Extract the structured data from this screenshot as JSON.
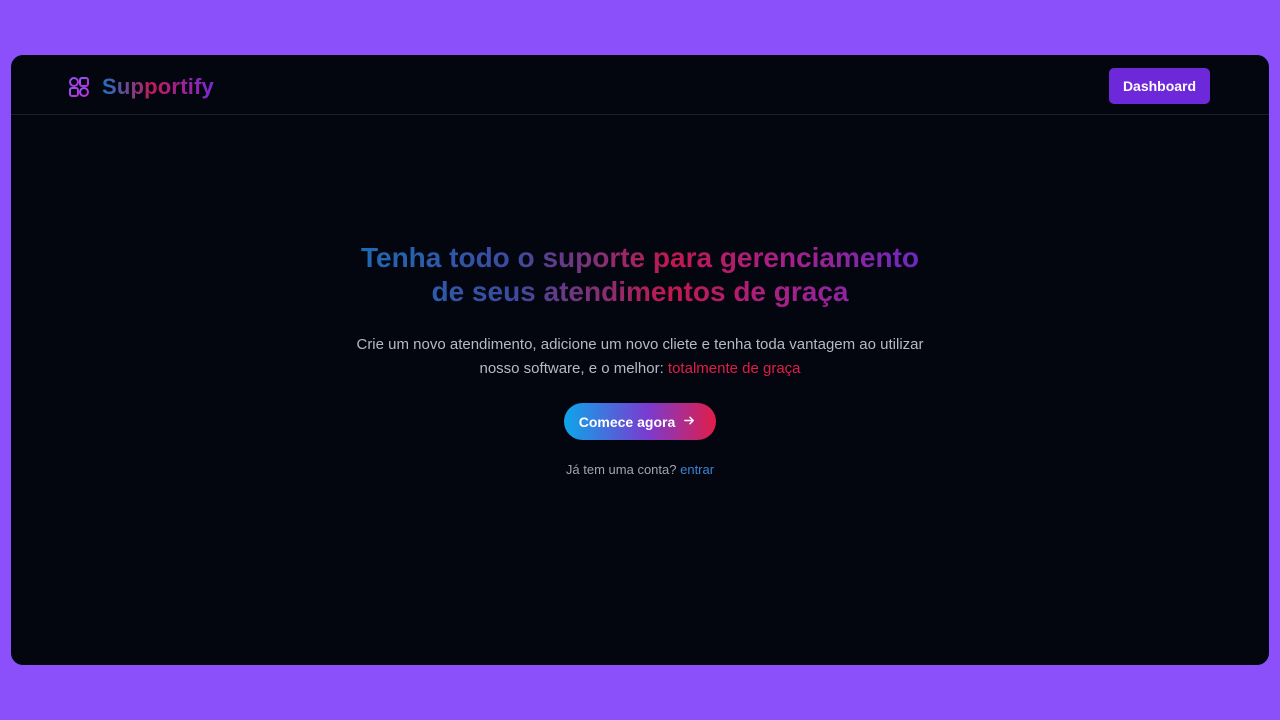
{
  "navbar": {
    "brand_name": "Supportify",
    "brand_icon": "grid-shapes-icon",
    "dashboard_label": "Dashboard"
  },
  "hero": {
    "headline_line1": "Tenha todo o suporte para gerenciamento",
    "headline_line2": "de seus atendimentos de graça",
    "subtitle_part1": "Crie um novo atendimento, adicione um novo cliete e tenha toda vantagem ao utilizar nosso software, e o melhor: ",
    "subtitle_highlight": "totalmente de graça",
    "cta_label": "Comece agora",
    "cta_icon": "arrow-right-icon",
    "login_prompt": "Já tem uma conta?",
    "login_link": "entrar"
  },
  "colors": {
    "page_background": "#8b50f9",
    "window_background": "#03060f",
    "dashboard_button": "#6d28d9",
    "highlight": "#e11d48",
    "link": "#3b82d6"
  }
}
